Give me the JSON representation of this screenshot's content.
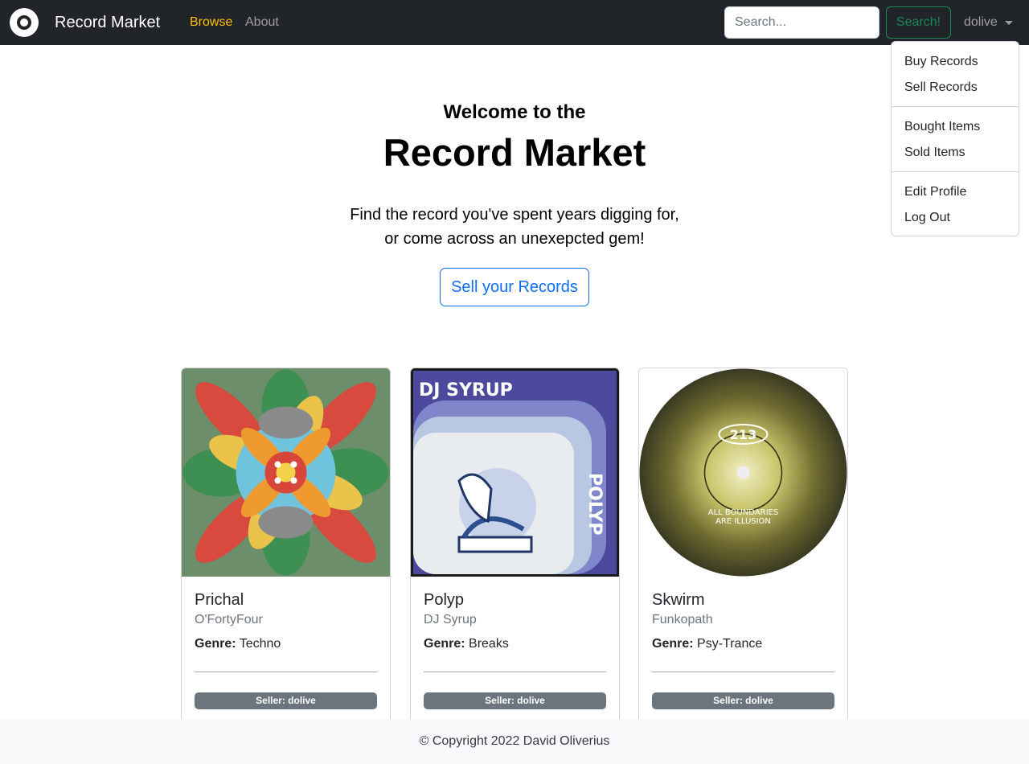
{
  "navbar": {
    "brand": "Record Market",
    "links": [
      {
        "label": "Browse",
        "active": true
      },
      {
        "label": "About",
        "active": false
      }
    ],
    "search": {
      "placeholder": "Search...",
      "value": "",
      "button_label": "Search!"
    },
    "user": "dolive"
  },
  "dropdown": {
    "groups": [
      [
        "Buy Records",
        "Sell Records"
      ],
      [
        "Bought Items",
        "Sold Items"
      ],
      [
        "Edit Profile",
        "Log Out"
      ]
    ]
  },
  "hero": {
    "subtitle": "Welcome to the",
    "title": "Record Market",
    "lead_line1": "Find the record you've spent years digging for,",
    "lead_line2": "or come across an unexepcted gem!",
    "button_label": "Sell your Records"
  },
  "cards": [
    {
      "title": "Prichal",
      "artist": "O'FortyFour",
      "genre_label": "Genre:",
      "genre": "Techno",
      "seller": "Seller: dolive"
    },
    {
      "title": "Polyp",
      "artist": "DJ Syrup",
      "genre_label": "Genre:",
      "genre": "Breaks",
      "seller": "Seller: dolive",
      "cover_text": "DJ SYRUP",
      "cover_side_text": "POLYP"
    },
    {
      "title": "Skwirm",
      "artist": "Funkopath",
      "genre_label": "Genre:",
      "genre": "Psy-Trance",
      "seller": "Seller: dolive",
      "label_logo": "213",
      "label_text1": "ALL BOUNDARIES",
      "label_text2": "ARE ILLUSION"
    }
  ],
  "footer": {
    "text": "© Copyright 2022 David Oliverius"
  },
  "colors": {
    "navbar": "#212529",
    "active_link": "#ffc107",
    "search_button": "#198754",
    "primary": "#0d6efd",
    "badge": "#6c757d"
  }
}
